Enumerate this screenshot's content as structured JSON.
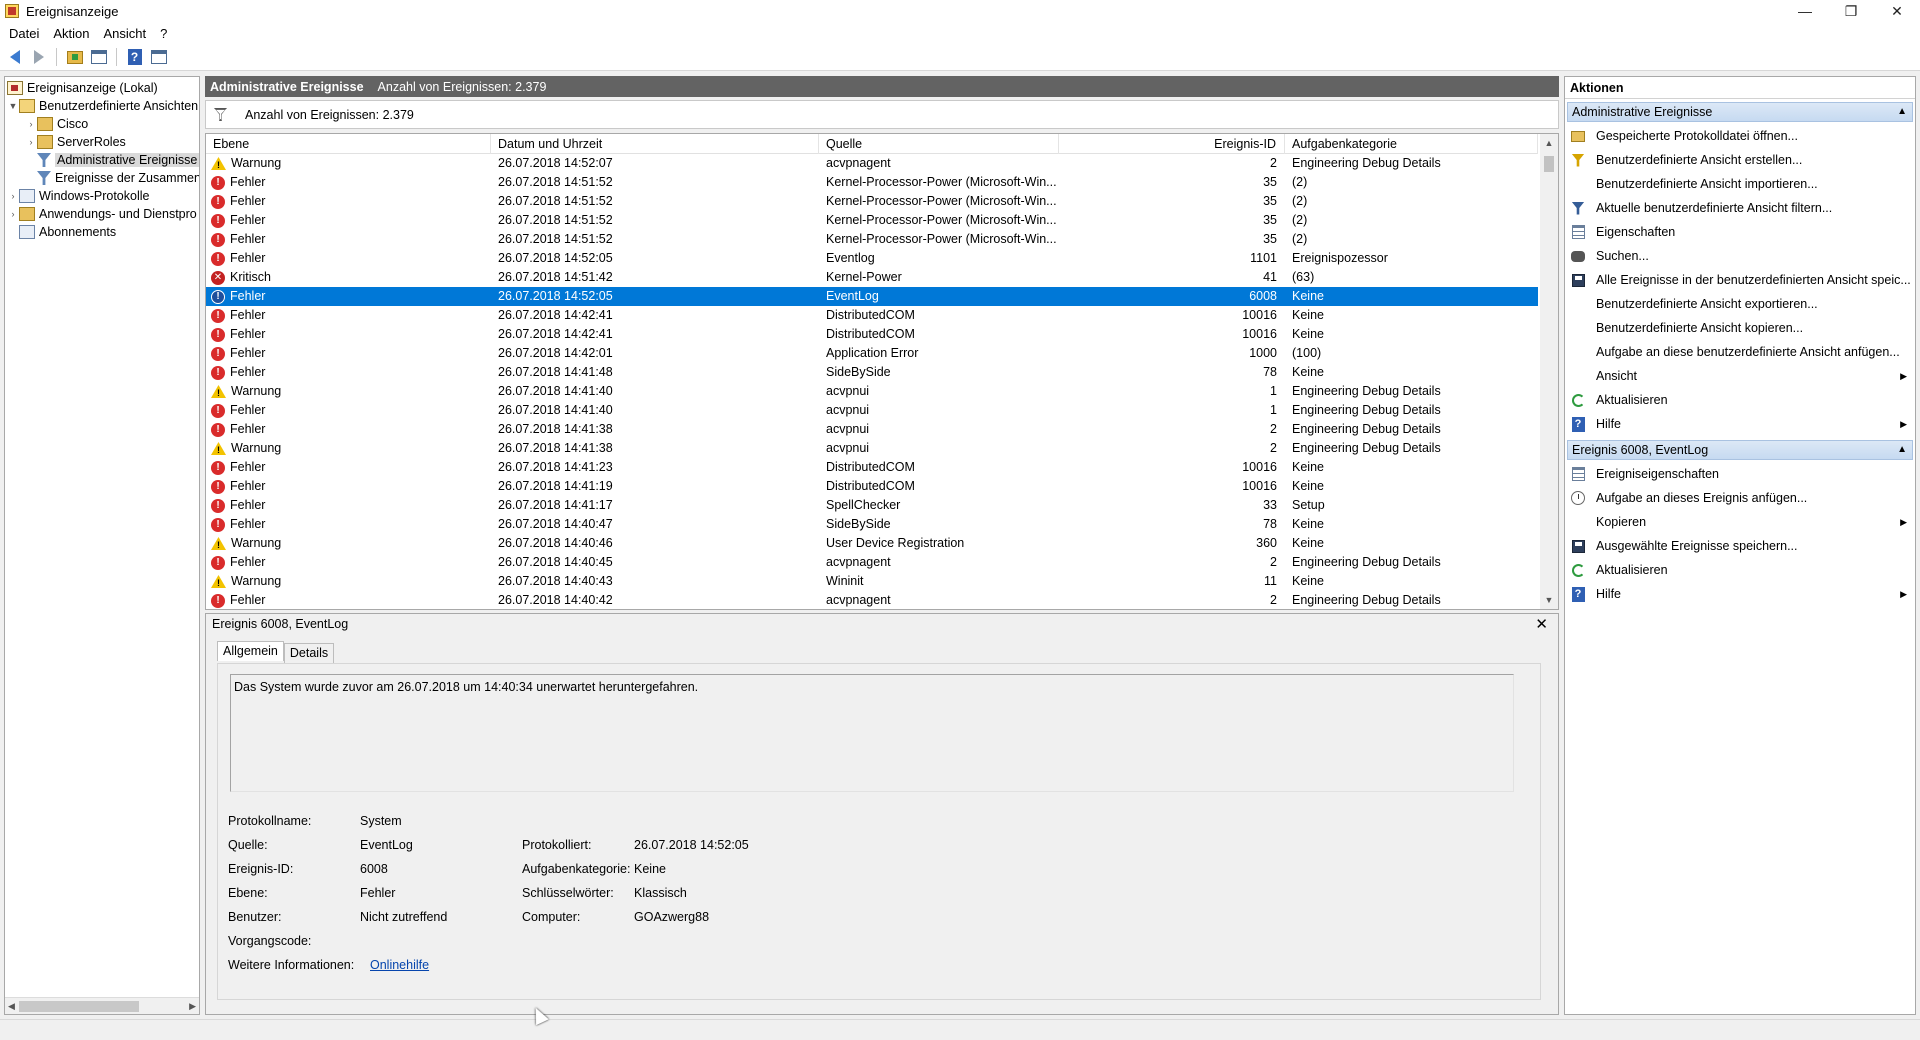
{
  "window": {
    "title": "Ereignisanzeige",
    "controls": {
      "minimize": "—",
      "restore": "❐",
      "close": "✕"
    }
  },
  "menu": [
    "Datei",
    "Aktion",
    "Ansicht",
    "?"
  ],
  "toolbar": {
    "icons": [
      "back-arrow-icon",
      "forward-arrow-icon",
      "folder-up-icon",
      "show-hide-tree-icon",
      "help-icon",
      "show-hide-action-icon"
    ]
  },
  "tree": {
    "root": "Ereignisanzeige (Lokal)",
    "custom_views": "Benutzerdefinierte Ansichten",
    "cisco": "Cisco",
    "server_roles": "ServerRoles",
    "admin_events": "Administrative Ereignisse",
    "summary_events": "Ereignisse der Zusammen",
    "windows_logs": "Windows-Protokolle",
    "app_service_logs": "Anwendungs- und Dienstpro",
    "subscriptions": "Abonnements"
  },
  "center": {
    "header_title": "Administrative Ereignisse",
    "header_count": "Anzahl von Ereignissen: 2.379",
    "filter_text": "Anzahl von Ereignissen: 2.379"
  },
  "events": {
    "columns": [
      "Ebene",
      "Datum und Uhrzeit",
      "Quelle",
      "Ereignis-ID",
      "Aufgabenkategorie"
    ],
    "rows": [
      {
        "level": "Warnung",
        "type": "warn",
        "date": "26.07.2018 14:52:07",
        "source": "acvpnagent",
        "id": "2",
        "cat": "Engineering Debug Details"
      },
      {
        "level": "Fehler",
        "type": "err",
        "date": "26.07.2018 14:51:52",
        "source": "Kernel-Processor-Power (Microsoft-Win...",
        "id": "35",
        "cat": "(2)"
      },
      {
        "level": "Fehler",
        "type": "err",
        "date": "26.07.2018 14:51:52",
        "source": "Kernel-Processor-Power (Microsoft-Win...",
        "id": "35",
        "cat": "(2)"
      },
      {
        "level": "Fehler",
        "type": "err",
        "date": "26.07.2018 14:51:52",
        "source": "Kernel-Processor-Power (Microsoft-Win...",
        "id": "35",
        "cat": "(2)"
      },
      {
        "level": "Fehler",
        "type": "err",
        "date": "26.07.2018 14:51:52",
        "source": "Kernel-Processor-Power (Microsoft-Win...",
        "id": "35",
        "cat": "(2)"
      },
      {
        "level": "Fehler",
        "type": "err",
        "date": "26.07.2018 14:52:05",
        "source": "Eventlog",
        "id": "1101",
        "cat": "Ereignispozessor"
      },
      {
        "level": "Kritisch",
        "type": "crit",
        "date": "26.07.2018 14:51:42",
        "source": "Kernel-Power",
        "id": "41",
        "cat": "(63)"
      },
      {
        "level": "Fehler",
        "type": "err",
        "date": "26.07.2018 14:52:05",
        "source": "EventLog",
        "id": "6008",
        "cat": "Keine",
        "selected": true
      },
      {
        "level": "Fehler",
        "type": "err",
        "date": "26.07.2018 14:42:41",
        "source": "DistributedCOM",
        "id": "10016",
        "cat": "Keine"
      },
      {
        "level": "Fehler",
        "type": "err",
        "date": "26.07.2018 14:42:41",
        "source": "DistributedCOM",
        "id": "10016",
        "cat": "Keine"
      },
      {
        "level": "Fehler",
        "type": "err",
        "date": "26.07.2018 14:42:01",
        "source": "Application Error",
        "id": "1000",
        "cat": "(100)"
      },
      {
        "level": "Fehler",
        "type": "err",
        "date": "26.07.2018 14:41:48",
        "source": "SideBySide",
        "id": "78",
        "cat": "Keine"
      },
      {
        "level": "Warnung",
        "type": "warn",
        "date": "26.07.2018 14:41:40",
        "source": "acvpnui",
        "id": "1",
        "cat": "Engineering Debug Details"
      },
      {
        "level": "Fehler",
        "type": "err",
        "date": "26.07.2018 14:41:40",
        "source": "acvpnui",
        "id": "1",
        "cat": "Engineering Debug Details"
      },
      {
        "level": "Fehler",
        "type": "err",
        "date": "26.07.2018 14:41:38",
        "source": "acvpnui",
        "id": "2",
        "cat": "Engineering Debug Details"
      },
      {
        "level": "Warnung",
        "type": "warn",
        "date": "26.07.2018 14:41:38",
        "source": "acvpnui",
        "id": "2",
        "cat": "Engineering Debug Details"
      },
      {
        "level": "Fehler",
        "type": "err",
        "date": "26.07.2018 14:41:23",
        "source": "DistributedCOM",
        "id": "10016",
        "cat": "Keine"
      },
      {
        "level": "Fehler",
        "type": "err",
        "date": "26.07.2018 14:41:19",
        "source": "DistributedCOM",
        "id": "10016",
        "cat": "Keine"
      },
      {
        "level": "Fehler",
        "type": "err",
        "date": "26.07.2018 14:41:17",
        "source": "SpellChecker",
        "id": "33",
        "cat": "Setup"
      },
      {
        "level": "Fehler",
        "type": "err",
        "date": "26.07.2018 14:40:47",
        "source": "SideBySide",
        "id": "78",
        "cat": "Keine"
      },
      {
        "level": "Warnung",
        "type": "warn",
        "date": "26.07.2018 14:40:46",
        "source": "User Device Registration",
        "id": "360",
        "cat": "Keine"
      },
      {
        "level": "Fehler",
        "type": "err",
        "date": "26.07.2018 14:40:45",
        "source": "acvpnagent",
        "id": "2",
        "cat": "Engineering Debug Details"
      },
      {
        "level": "Warnung",
        "type": "warn",
        "date": "26.07.2018 14:40:43",
        "source": "Wininit",
        "id": "11",
        "cat": "Keine"
      },
      {
        "level": "Fehler",
        "type": "err",
        "date": "26.07.2018 14:40:42",
        "source": "acvpnagent",
        "id": "2",
        "cat": "Engineering Debug Details"
      }
    ]
  },
  "detail": {
    "title": "Ereignis 6008, EventLog",
    "tabs": [
      "Allgemein",
      "Details"
    ],
    "message": "Das System wurde zuvor am 26.07.2018 um 14:40:34 unerwartet heruntergefahren.",
    "labels": {
      "log_name": "Protokollname:",
      "source": "Quelle:",
      "event_id": "Ereignis-ID:",
      "level": "Ebene:",
      "user": "Benutzer:",
      "opcode": "Vorgangscode:",
      "more_info": "Weitere Informationen:",
      "logged": "Protokolliert:",
      "task_category": "Aufgabenkategorie:",
      "keywords": "Schlüsselwörter:",
      "computer": "Computer:"
    },
    "values": {
      "log_name": "System",
      "source": "EventLog",
      "event_id": "6008",
      "level": "Fehler",
      "user": "Nicht zutreffend",
      "opcode": "",
      "more_info": "Onlinehilfe",
      "logged": "26.07.2018 14:52:05",
      "task_category": "Keine",
      "keywords": "Klassisch",
      "computer": "GOAzwerg88"
    }
  },
  "actions": {
    "header": "Aktionen",
    "section1": {
      "title": "Administrative Ereignisse",
      "items": [
        {
          "label": "Gespeicherte Protokolldatei öffnen...",
          "icon": "open-log-icon"
        },
        {
          "label": "Benutzerdefinierte Ansicht erstellen...",
          "icon": "create-view-icon"
        },
        {
          "label": "Benutzerdefinierte Ansicht importieren...",
          "icon": ""
        },
        {
          "label": "Aktuelle benutzerdefinierte Ansicht filtern...",
          "icon": "filter-icon"
        },
        {
          "label": "Eigenschaften",
          "icon": "properties-icon"
        },
        {
          "label": "Suchen...",
          "icon": "find-icon"
        },
        {
          "label": "Alle Ereignisse in der benutzerdefinierten Ansicht speic...",
          "icon": "save-icon"
        },
        {
          "label": "Benutzerdefinierte Ansicht exportieren...",
          "icon": ""
        },
        {
          "label": "Benutzerdefinierte Ansicht kopieren...",
          "icon": ""
        },
        {
          "label": "Aufgabe an diese benutzerdefinierte Ansicht anfügen...",
          "icon": ""
        },
        {
          "label": "Ansicht",
          "icon": "",
          "submenu": true
        },
        {
          "label": "Aktualisieren",
          "icon": "refresh-icon"
        },
        {
          "label": "Hilfe",
          "icon": "help-icon",
          "submenu": true
        }
      ]
    },
    "section2": {
      "title": "Ereignis 6008, EventLog",
      "items": [
        {
          "label": "Ereigniseigenschaften",
          "icon": "properties-icon"
        },
        {
          "label": "Aufgabe an dieses Ereignis anfügen...",
          "icon": "task-icon"
        },
        {
          "label": "Kopieren",
          "icon": "copy-icon",
          "submenu": true
        },
        {
          "label": "Ausgewählte Ereignisse speichern...",
          "icon": "save-icon"
        },
        {
          "label": "Aktualisieren",
          "icon": "refresh-icon"
        },
        {
          "label": "Hilfe",
          "icon": "help-icon",
          "submenu": true
        }
      ]
    }
  }
}
